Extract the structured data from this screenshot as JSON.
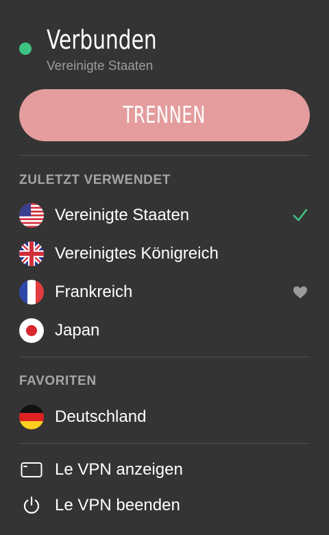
{
  "status": {
    "title": "Verbunden",
    "location": "Vereinigte Staaten",
    "color": "#3fc383"
  },
  "disconnect_label": "TRENNEN",
  "recent": {
    "heading": "ZULETZT VERWENDET",
    "items": [
      {
        "label": "Vereinigte Staaten",
        "flag": "us-flag-icon",
        "selected": true
      },
      {
        "label": "Vereinigtes Königreich",
        "flag": "uk-flag-icon"
      },
      {
        "label": "Frankreich",
        "flag": "france-flag-icon",
        "favorite": true
      },
      {
        "label": "Japan",
        "flag": "japan-flag-icon"
      }
    ]
  },
  "favorites": {
    "heading": "FAVORITEN",
    "items": [
      {
        "label": "Deutschland",
        "flag": "germany-flag-icon"
      }
    ]
  },
  "menu": {
    "show_label": "Le VPN anzeigen",
    "quit_label": "Le VPN beenden"
  },
  "colors": {
    "accent": "#3fc383",
    "disconnect": "#e49c9c",
    "background": "#343434"
  }
}
